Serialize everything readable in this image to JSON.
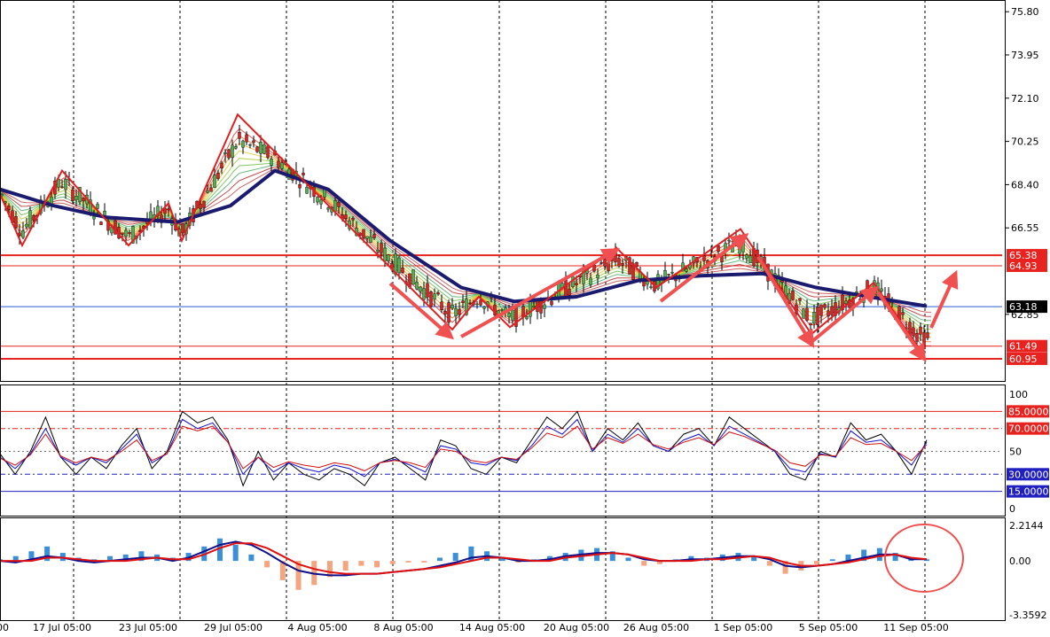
{
  "colors": {
    "background": "#ffffff",
    "grid": "#000000",
    "level_line": "#e8231f",
    "current_line": "#2a5bd7",
    "ma_main": "#1a1a6e",
    "zigzag": "#e02020",
    "arrow": "#f05050",
    "rsi_black": "#000000",
    "rsi_blue": "#1010d0",
    "rsi_red": "#d01010",
    "hist_pos": "#3a8fd8",
    "hist_neg": "#f4a580",
    "macd_blue": "#10108a",
    "macd_red": "#e01010"
  },
  "chart_data": [
    {
      "type": "line",
      "panel": "price",
      "categories": [
        "17 Jul 05:00",
        "23 Jul 05:00",
        "29 Jul 05:00",
        "4 Aug 05:00",
        "8 Aug 05:00",
        "14 Aug 05:00",
        "20 Aug 05:00",
        "26 Aug 05:00",
        "1 Sep 05:00",
        "5 Sep 05:00",
        "11 Sep 05:00"
      ],
      "ylim": [
        60.0,
        76.3
      ],
      "yticks": [
        "75.80",
        "73.95",
        "72.10",
        "70.25",
        "68.40",
        "66.55",
        "62.85"
      ],
      "levels": [
        {
          "label": "65.38",
          "value": 65.38
        },
        {
          "label": "64.93",
          "value": 64.93
        },
        {
          "label": "61.49",
          "value": 61.49
        },
        {
          "label": "60.95",
          "value": 60.95
        }
      ],
      "current": {
        "label": "63.18",
        "value": 63.18
      },
      "zigzag": [
        [
          0,
          68.0
        ],
        [
          25,
          65.8
        ],
        [
          70,
          69.0
        ],
        [
          145,
          65.8
        ],
        [
          190,
          67.6
        ],
        [
          205,
          66.0
        ],
        [
          268,
          71.4
        ],
        [
          510,
          62.2
        ],
        [
          540,
          63.6
        ],
        [
          575,
          62.3
        ],
        [
          695,
          65.7
        ],
        [
          740,
          64.0
        ],
        [
          835,
          66.5
        ],
        [
          915,
          62.0
        ],
        [
          985,
          64.2
        ],
        [
          1040,
          61.2
        ]
      ],
      "ma_path": [
        [
          0,
          68.2
        ],
        [
          60,
          67.5
        ],
        [
          120,
          67.0
        ],
        [
          200,
          66.8
        ],
        [
          260,
          67.5
        ],
        [
          310,
          69.0
        ],
        [
          370,
          68.2
        ],
        [
          440,
          66.0
        ],
        [
          520,
          64.0
        ],
        [
          580,
          63.4
        ],
        [
          650,
          63.6
        ],
        [
          720,
          64.3
        ],
        [
          790,
          64.5
        ],
        [
          860,
          64.6
        ],
        [
          920,
          64.0
        ],
        [
          980,
          63.6
        ],
        [
          1045,
          63.2
        ]
      ],
      "arrows": [
        [
          [
            440,
            320
          ],
          [
            506,
            378
          ]
        ],
        [
          [
            520,
            380
          ],
          [
            692,
            284
          ]
        ],
        [
          [
            745,
            340
          ],
          [
            838,
            268
          ]
        ],
        [
          [
            855,
            290
          ],
          [
            914,
            386
          ]
        ],
        [
          [
            915,
            386
          ],
          [
            985,
            328
          ]
        ],
        [
          [
            990,
            330
          ],
          [
            1040,
            402
          ]
        ],
        [
          [
            1050,
            370
          ],
          [
            1076,
            312
          ]
        ]
      ]
    },
    {
      "type": "line",
      "panel": "oscillator",
      "ylim": [
        0,
        100
      ],
      "yticks": [
        "100",
        "50",
        "0"
      ],
      "levels": [
        {
          "label": "85.0000",
          "value": 85
        },
        {
          "label": "70.0000",
          "value": 70
        },
        {
          "label": "30.0000",
          "value": 30
        },
        {
          "label": "15.0000",
          "value": 15
        }
      ],
      "series": [
        {
          "values": [
            48,
            30,
            50,
            80,
            45,
            30,
            45,
            35,
            55,
            70,
            35,
            50,
            85,
            75,
            80,
            60,
            20,
            50,
            25,
            40,
            30,
            25,
            35,
            30,
            20,
            40,
            45,
            35,
            25,
            60,
            55,
            35,
            30,
            45,
            40,
            60,
            80,
            70,
            85,
            50,
            70,
            60,
            75,
            55,
            50,
            65,
            70,
            55,
            80,
            70,
            60,
            50,
            30,
            25,
            50,
            45,
            75,
            60,
            65,
            50,
            30,
            60
          ]
        },
        {
          "values": [
            45,
            35,
            48,
            70,
            45,
            38,
            45,
            40,
            52,
            65,
            40,
            48,
            78,
            70,
            75,
            58,
            30,
            45,
            32,
            40,
            35,
            32,
            38,
            35,
            28,
            40,
            43,
            38,
            32,
            55,
            52,
            40,
            38,
            45,
            42,
            55,
            72,
            65,
            78,
            50,
            65,
            58,
            70,
            55,
            50,
            60,
            65,
            55,
            72,
            65,
            58,
            50,
            35,
            32,
            48,
            45,
            68,
            58,
            60,
            50,
            38,
            58
          ]
        },
        {
          "values": [
            44,
            38,
            47,
            65,
            46,
            40,
            45,
            42,
            50,
            60,
            42,
            48,
            72,
            68,
            72,
            58,
            35,
            45,
            36,
            41,
            38,
            36,
            40,
            38,
            33,
            40,
            42,
            40,
            36,
            52,
            50,
            42,
            40,
            45,
            43,
            53,
            66,
            62,
            72,
            52,
            62,
            57,
            65,
            56,
            52,
            58,
            62,
            56,
            67,
            63,
            57,
            51,
            40,
            37,
            47,
            46,
            62,
            56,
            57,
            50,
            42,
            56
          ]
        }
      ]
    },
    {
      "type": "bar",
      "panel": "macd",
      "ylim": [
        -3.3592,
        2.2144
      ],
      "yticks": [
        "2.2144",
        "0.00",
        "-3.3592"
      ],
      "series": [
        {
          "values": [
            0.1,
            0.3,
            0.6,
            0.9,
            0.5,
            0.2,
            0.1,
            0.3,
            0.4,
            0.6,
            0.4,
            0.2,
            0.5,
            0.9,
            1.4,
            1.0,
            0.4,
            -0.4,
            -1.2,
            -1.8,
            -1.5,
            -1.0,
            -0.6,
            -0.3,
            -0.4,
            -0.2,
            -0.1,
            -0.1,
            0.2,
            0.5,
            0.9,
            0.6,
            0.2,
            -0.1,
            0.1,
            0.3,
            0.5,
            0.7,
            0.8,
            0.6,
            0.2,
            -0.3,
            -0.2,
            0.1,
            0.3,
            0.2,
            0.4,
            0.5,
            0.3,
            -0.3,
            -0.8,
            -0.6,
            -0.2,
            0.1,
            0.4,
            0.7,
            0.8,
            0.5,
            0.1,
            0.1
          ]
        },
        {
          "values": [
            0.0,
            -0.1,
            0.1,
            0.3,
            0.2,
            0.0,
            -0.1,
            0.0,
            0.1,
            0.2,
            0.2,
            0.0,
            0.2,
            0.6,
            1.0,
            1.2,
            1.0,
            0.5,
            -0.1,
            -0.6,
            -0.8,
            -0.9,
            -0.9,
            -0.8,
            -0.8,
            -0.7,
            -0.6,
            -0.5,
            -0.3,
            -0.1,
            0.2,
            0.3,
            0.2,
            0.0,
            0.0,
            0.1,
            0.3,
            0.4,
            0.5,
            0.5,
            0.4,
            0.1,
            0.0,
            0.0,
            0.1,
            0.1,
            0.2,
            0.3,
            0.3,
            0.1,
            -0.3,
            -0.4,
            -0.3,
            -0.2,
            0.0,
            0.2,
            0.4,
            0.4,
            0.1,
            0.1
          ]
        },
        {
          "values": [
            0.0,
            0.0,
            0.0,
            0.2,
            0.2,
            0.1,
            0.0,
            0.0,
            0.0,
            0.1,
            0.2,
            0.1,
            0.1,
            0.4,
            0.8,
            1.1,
            1.1,
            0.8,
            0.3,
            -0.2,
            -0.5,
            -0.7,
            -0.8,
            -0.8,
            -0.8,
            -0.7,
            -0.6,
            -0.5,
            -0.4,
            -0.2,
            0.0,
            0.2,
            0.2,
            0.1,
            0.0,
            0.0,
            0.2,
            0.3,
            0.4,
            0.5,
            0.4,
            0.2,
            0.0,
            0.0,
            0.0,
            0.1,
            0.1,
            0.2,
            0.3,
            0.2,
            -0.1,
            -0.3,
            -0.3,
            -0.2,
            -0.1,
            0.1,
            0.3,
            0.4,
            0.2,
            0.1
          ]
        }
      ]
    }
  ]
}
